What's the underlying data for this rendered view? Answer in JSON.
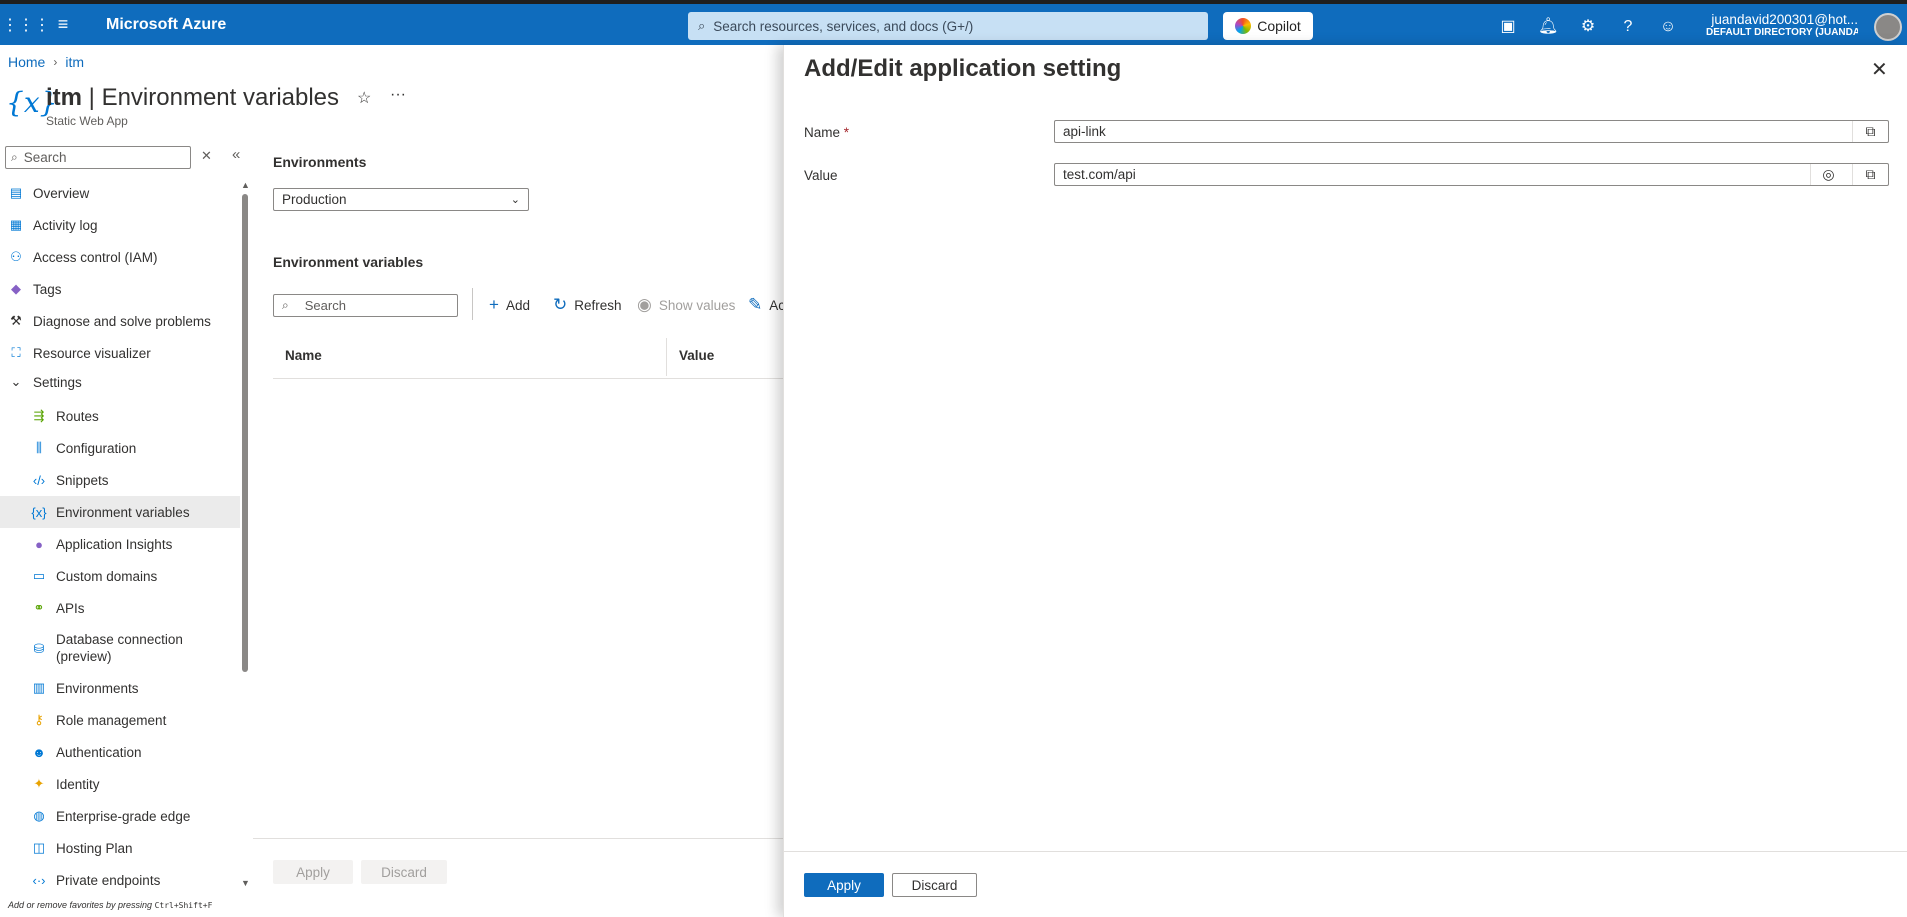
{
  "topbar": {
    "brand": "Microsoft Azure",
    "search_placeholder": "Search resources, services, and docs (G+/)",
    "copilot_label": "Copilot",
    "account_user": "juandavid200301@hot...",
    "account_directory": "DEFAULT DIRECTORY (JUANDAVI...",
    "icons": [
      "cloud-shell-icon",
      "notifications-icon",
      "settings-icon",
      "help-icon",
      "feedback-icon"
    ]
  },
  "breadcrumb": {
    "home": "Home",
    "current": "itm"
  },
  "page": {
    "resource_name": "itm",
    "title_suffix": "| Environment variables",
    "subtitle": "Static Web App"
  },
  "sidebar": {
    "search_placeholder": "Search",
    "items": [
      {
        "label": "Overview",
        "icon": "overview-icon"
      },
      {
        "label": "Activity log",
        "icon": "activity-log-icon"
      },
      {
        "label": "Access control (IAM)",
        "icon": "iam-icon"
      },
      {
        "label": "Tags",
        "icon": "tag-icon"
      },
      {
        "label": "Diagnose and solve problems",
        "icon": "wrench-icon"
      },
      {
        "label": "Resource visualizer",
        "icon": "visualizer-icon"
      },
      {
        "label": "Settings",
        "icon": "chevron-down-icon"
      },
      {
        "label": "Routes",
        "icon": "routes-icon"
      },
      {
        "label": "Configuration",
        "icon": "configuration-icon"
      },
      {
        "label": "Snippets",
        "icon": "code-icon"
      },
      {
        "label": "Environment variables",
        "icon": "variable-icon"
      },
      {
        "label": "Application Insights",
        "icon": "insights-icon"
      },
      {
        "label": "Custom domains",
        "icon": "domain-icon"
      },
      {
        "label": "APIs",
        "icon": "api-icon"
      },
      {
        "label": "Database connection (preview)",
        "icon": "database-icon"
      },
      {
        "label": "Environments",
        "icon": "environments-icon"
      },
      {
        "label": "Role management",
        "icon": "key-icon"
      },
      {
        "label": "Authentication",
        "icon": "person-icon"
      },
      {
        "label": "Identity",
        "icon": "identity-icon"
      },
      {
        "label": "Enterprise-grade edge",
        "icon": "globe-icon"
      },
      {
        "label": "Hosting Plan",
        "icon": "plan-icon"
      },
      {
        "label": "Private endpoints",
        "icon": "endpoint-icon"
      }
    ],
    "favorites_tip_text": "Add or remove favorites by pressing",
    "favorites_tip_keys": "Ctrl+Shift+F"
  },
  "content": {
    "environments_label": "Environments",
    "environment_selected": "Production",
    "env_vars_label": "Environment variables",
    "search_placeholder": "Search",
    "toolbar": {
      "add": "Add",
      "refresh": "Refresh",
      "show_values": "Show values",
      "advanced": "Ac"
    },
    "columns": [
      "Name",
      "Value"
    ],
    "apply": "Apply",
    "discard": "Discard"
  },
  "panel": {
    "title": "Add/Edit application setting",
    "name_label": "Name",
    "required_mark": "*",
    "name_value": "api-link",
    "value_label": "Value",
    "value_value": "test.com/api",
    "apply": "Apply",
    "discard": "Discard"
  },
  "colors": {
    "accent": "#0f6cbd",
    "topbar": "#0f6cbd",
    "search_bg": "#c7e0f4"
  }
}
